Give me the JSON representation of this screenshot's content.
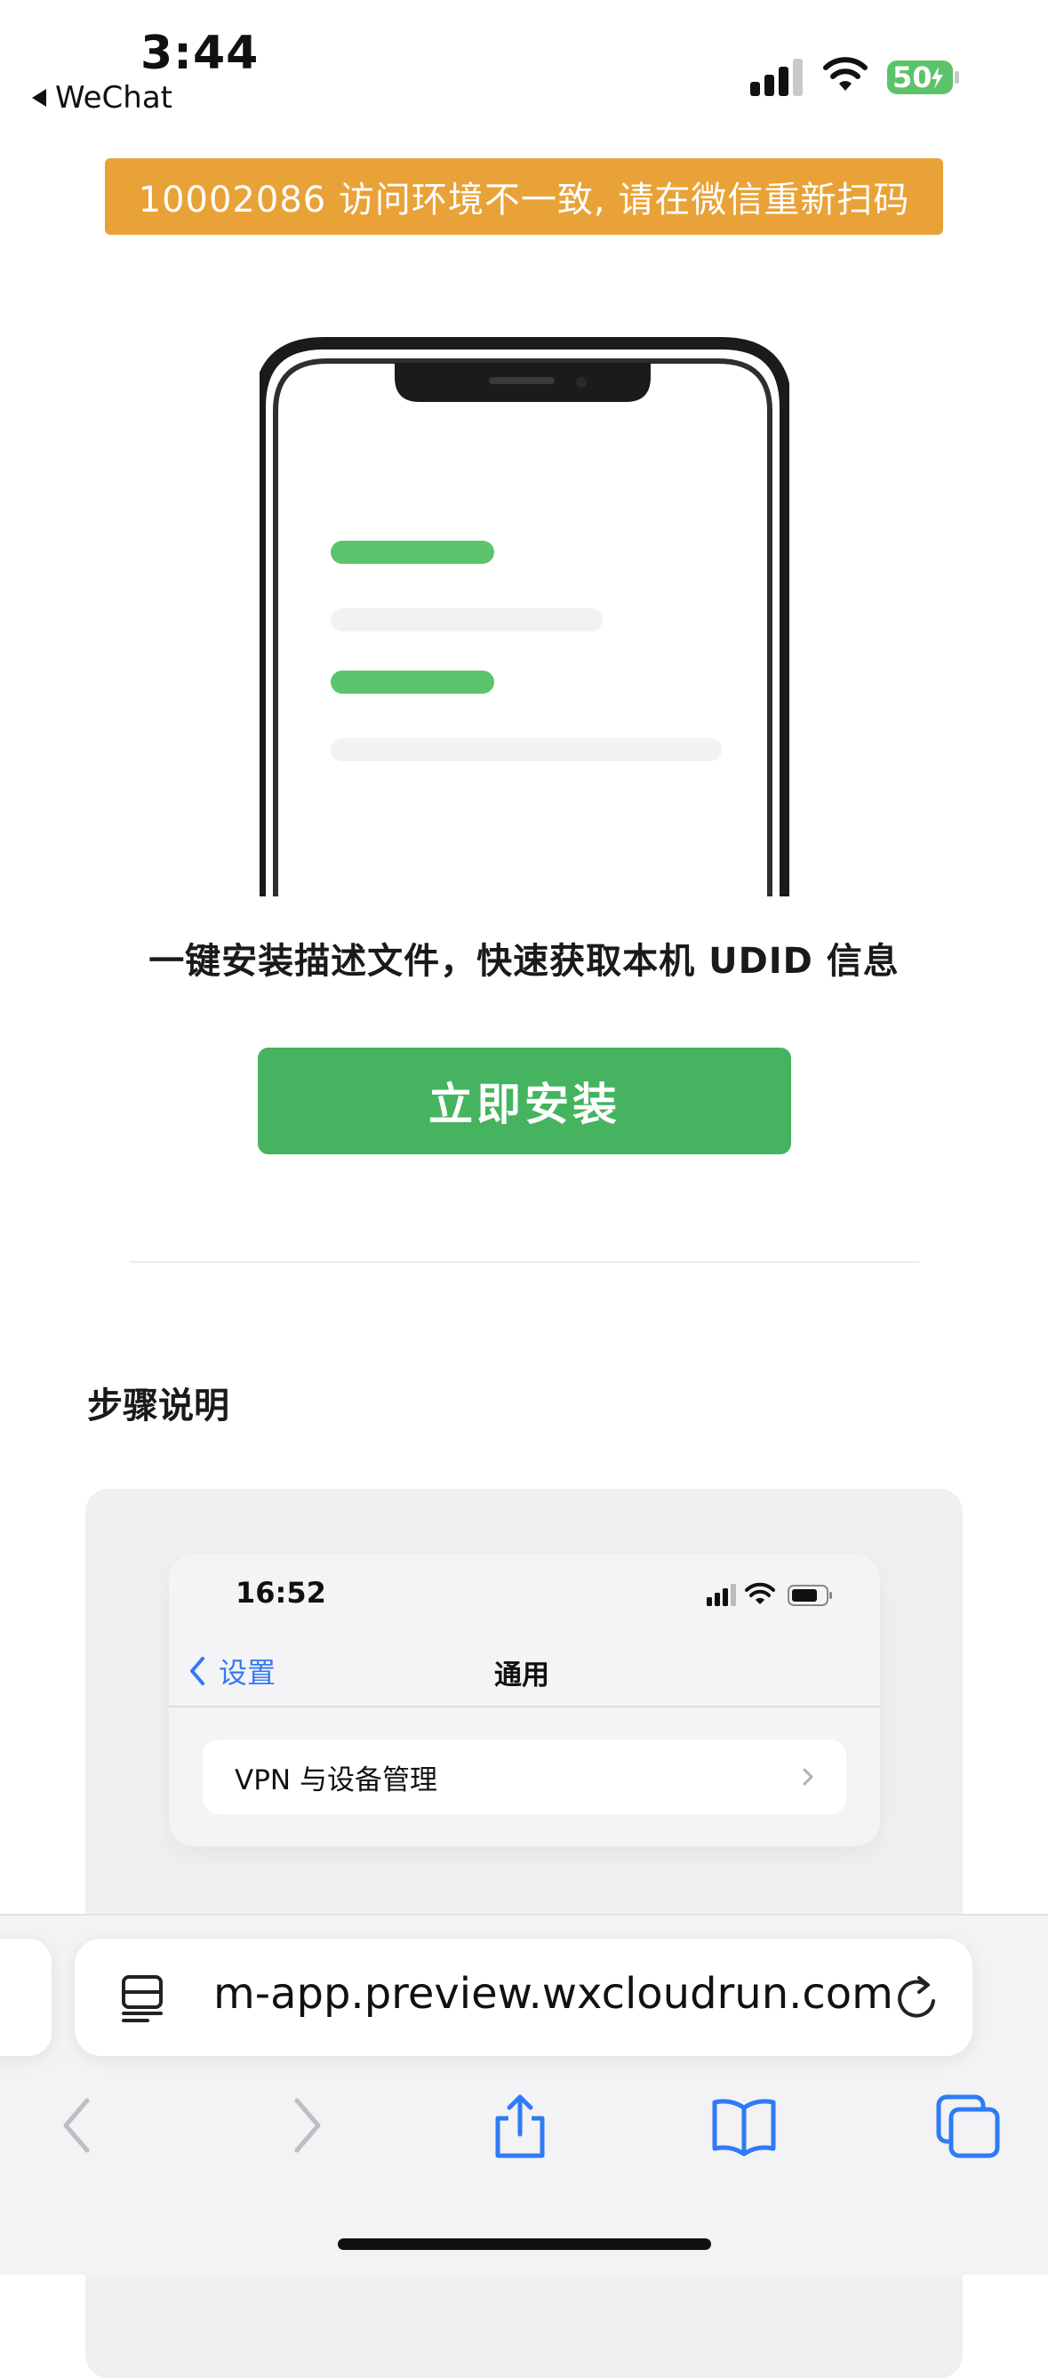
{
  "status_bar": {
    "time": "3:44",
    "back_app": "WeChat",
    "battery_level": "50",
    "battery_charging": true
  },
  "error_banner": {
    "text": "10002086 访问环境不一致, 请在微信重新扫码",
    "color": "#E9A237"
  },
  "illustration": {
    "name": "phone-with-list-illustration",
    "accent_color": "#5CC46C"
  },
  "headline": "一键安装描述文件，快速获取本机 UDID 信息",
  "install_button": {
    "label": "立即安装",
    "color": "#45B35F"
  },
  "steps": {
    "title": "步骤说明",
    "mock_screen": {
      "time": "16:52",
      "back_label": "设置",
      "nav_title": "通用",
      "row_label": "VPN 与设备管理"
    }
  },
  "safari": {
    "address": "m-app.preview.wxcloudrun.com",
    "icons": [
      "reader-icon",
      "reload-icon",
      "back-icon",
      "forward-icon",
      "share-icon",
      "bookmarks-icon",
      "tabs-icon"
    ]
  }
}
